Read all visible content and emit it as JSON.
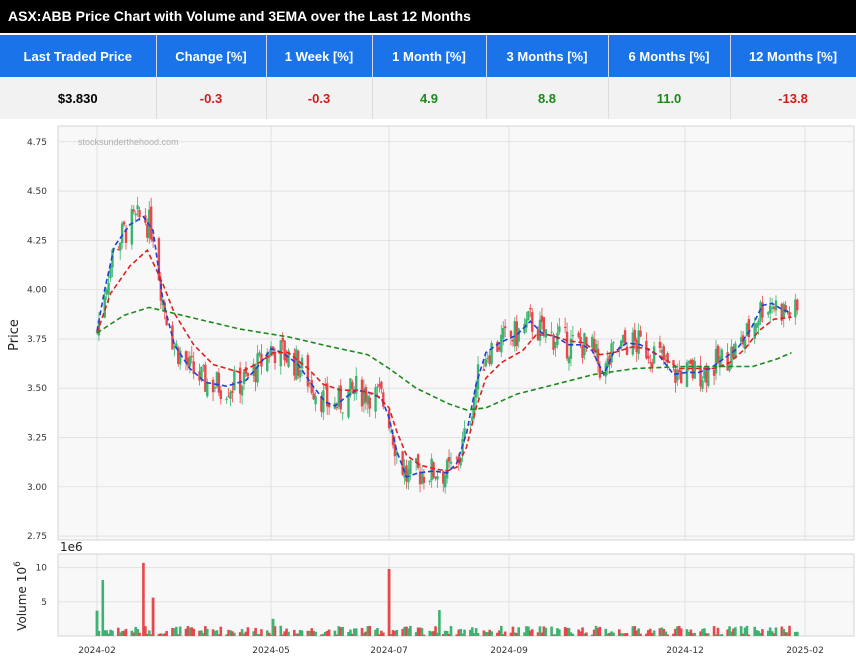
{
  "title": "ASX:ABB Price Chart with Volume and 3EMA over the Last 12 Months",
  "stats": {
    "headers": [
      "Last Traded Price",
      "Change [%]",
      "1 Week [%]",
      "1 Month [%]",
      "3 Months [%]",
      "6 Months [%]",
      "12 Months [%]"
    ],
    "values": [
      "$3.830",
      "-0.3",
      "-0.3",
      "4.9",
      "8.8",
      "11.0",
      "-13.8"
    ],
    "value_colors": [
      "#000000",
      "#d61a1a",
      "#d61a1a",
      "#1a8a1a",
      "#1a8a1a",
      "#1a8a1a",
      "#d61a1a"
    ]
  },
  "chart_data": {
    "type": "line",
    "watermark": "stocksunderthehood.com",
    "ylabel": "Price",
    "volume_label": "Volume",
    "volume_unit": "1e6",
    "volume_exponent_label": "10",
    "volume_exponent": "6",
    "x_ticks": [
      "2024-02",
      "2024-05",
      "2024-07",
      "2024-09",
      "2024-12",
      "2025-02"
    ],
    "x_tick_dates": [
      "2024-02-01",
      "2024-05-01",
      "2024-07-01",
      "2024-09-01",
      "2024-12-01",
      "2025-02-01"
    ],
    "y_ticks": [
      "2.75",
      "3.00",
      "3.25",
      "3.50",
      "3.75",
      "4.00",
      "4.25",
      "4.50",
      "4.75"
    ],
    "ylim": [
      2.73,
      4.83
    ],
    "volume_ticks": [
      "5",
      "10"
    ],
    "volume_ylim": [
      0,
      12
    ],
    "grid": true,
    "up_color": "#3cb371",
    "down_color": "#e8474b",
    "series": [
      {
        "color": "#1f3fd6",
        "style": "dashed",
        "points": [
          [
            "2024-02-01",
            3.79
          ],
          [
            "2024-02-05",
            4.0
          ],
          [
            "2024-02-10",
            4.22
          ],
          [
            "2024-02-18",
            4.33
          ],
          [
            "2024-02-25",
            4.37
          ],
          [
            "2024-03-01",
            4.3
          ],
          [
            "2024-03-06",
            3.95
          ],
          [
            "2024-03-12",
            3.72
          ],
          [
            "2024-03-20",
            3.6
          ],
          [
            "2024-03-28",
            3.53
          ],
          [
            "2024-04-08",
            3.51
          ],
          [
            "2024-04-18",
            3.54
          ],
          [
            "2024-04-25",
            3.62
          ],
          [
            "2024-05-01",
            3.7
          ],
          [
            "2024-05-07",
            3.68
          ],
          [
            "2024-05-15",
            3.62
          ],
          [
            "2024-05-22",
            3.52
          ],
          [
            "2024-05-29",
            3.43
          ],
          [
            "2024-06-03",
            3.41
          ],
          [
            "2024-06-08",
            3.45
          ],
          [
            "2024-06-14",
            3.49
          ],
          [
            "2024-06-20",
            3.48
          ],
          [
            "2024-06-27",
            3.45
          ],
          [
            "2024-07-01",
            3.35
          ],
          [
            "2024-07-05",
            3.18
          ],
          [
            "2024-07-10",
            3.05
          ],
          [
            "2024-07-16",
            3.07
          ],
          [
            "2024-07-24",
            3.08
          ],
          [
            "2024-07-31",
            3.07
          ],
          [
            "2024-08-05",
            3.12
          ],
          [
            "2024-08-10",
            3.27
          ],
          [
            "2024-08-15",
            3.52
          ],
          [
            "2024-08-20",
            3.68
          ],
          [
            "2024-08-27",
            3.73
          ],
          [
            "2024-09-05",
            3.77
          ],
          [
            "2024-09-12",
            3.84
          ],
          [
            "2024-09-18",
            3.78
          ],
          [
            "2024-09-25",
            3.76
          ],
          [
            "2024-10-02",
            3.72
          ],
          [
            "2024-10-09",
            3.72
          ],
          [
            "2024-10-14",
            3.69
          ],
          [
            "2024-10-20",
            3.57
          ],
          [
            "2024-10-25",
            3.68
          ],
          [
            "2024-11-01",
            3.73
          ],
          [
            "2024-11-08",
            3.72
          ],
          [
            "2024-11-13",
            3.69
          ],
          [
            "2024-11-18",
            3.66
          ],
          [
            "2024-11-25",
            3.57
          ],
          [
            "2024-12-02",
            3.58
          ],
          [
            "2024-12-08",
            3.58
          ],
          [
            "2024-12-14",
            3.6
          ],
          [
            "2024-12-21",
            3.65
          ],
          [
            "2024-12-28",
            3.7
          ],
          [
            "2025-01-04",
            3.8
          ],
          [
            "2025-01-10",
            3.92
          ],
          [
            "2025-01-15",
            3.93
          ],
          [
            "2025-01-20",
            3.9
          ],
          [
            "2025-01-25",
            3.88
          ]
        ]
      },
      {
        "color": "#e02020",
        "style": "dashed",
        "points": [
          [
            "2024-02-01",
            3.78
          ],
          [
            "2024-02-08",
            3.98
          ],
          [
            "2024-02-18",
            4.12
          ],
          [
            "2024-02-27",
            4.2
          ],
          [
            "2024-03-06",
            4.03
          ],
          [
            "2024-03-12",
            3.88
          ],
          [
            "2024-03-22",
            3.72
          ],
          [
            "2024-04-01",
            3.62
          ],
          [
            "2024-04-15",
            3.58
          ],
          [
            "2024-04-25",
            3.63
          ],
          [
            "2024-05-02",
            3.68
          ],
          [
            "2024-05-10",
            3.68
          ],
          [
            "2024-05-20",
            3.6
          ],
          [
            "2024-05-28",
            3.52
          ],
          [
            "2024-06-06",
            3.49
          ],
          [
            "2024-06-15",
            3.49
          ],
          [
            "2024-06-24",
            3.47
          ],
          [
            "2024-07-01",
            3.4
          ],
          [
            "2024-07-05",
            3.28
          ],
          [
            "2024-07-10",
            3.16
          ],
          [
            "2024-07-17",
            3.11
          ],
          [
            "2024-07-25",
            3.09
          ],
          [
            "2024-07-31",
            3.08
          ],
          [
            "2024-08-05",
            3.1
          ],
          [
            "2024-08-10",
            3.2
          ],
          [
            "2024-08-15",
            3.4
          ],
          [
            "2024-08-20",
            3.55
          ],
          [
            "2024-08-28",
            3.63
          ],
          [
            "2024-09-08",
            3.69
          ],
          [
            "2024-09-15",
            3.77
          ],
          [
            "2024-09-22",
            3.77
          ],
          [
            "2024-10-02",
            3.74
          ],
          [
            "2024-10-10",
            3.73
          ],
          [
            "2024-10-18",
            3.67
          ],
          [
            "2024-10-25",
            3.68
          ],
          [
            "2024-11-04",
            3.71
          ],
          [
            "2024-11-12",
            3.7
          ],
          [
            "2024-11-20",
            3.65
          ],
          [
            "2024-11-28",
            3.6
          ],
          [
            "2024-12-08",
            3.6
          ],
          [
            "2024-12-16",
            3.6
          ],
          [
            "2024-12-24",
            3.63
          ],
          [
            "2025-01-01",
            3.7
          ],
          [
            "2025-01-08",
            3.79
          ],
          [
            "2025-01-16",
            3.85
          ],
          [
            "2025-01-25",
            3.86
          ]
        ]
      },
      {
        "color": "#1e8a1e",
        "style": "dashed",
        "points": [
          [
            "2024-02-01",
            3.78
          ],
          [
            "2024-02-15",
            3.87
          ],
          [
            "2024-02-28",
            3.91
          ],
          [
            "2024-03-20",
            3.86
          ],
          [
            "2024-04-15",
            3.8
          ],
          [
            "2024-05-10",
            3.76
          ],
          [
            "2024-06-01",
            3.71
          ],
          [
            "2024-06-20",
            3.67
          ],
          [
            "2024-07-01",
            3.6
          ],
          [
            "2024-07-15",
            3.5
          ],
          [
            "2024-08-01",
            3.42
          ],
          [
            "2024-08-10",
            3.39
          ],
          [
            "2024-08-20",
            3.4
          ],
          [
            "2024-09-05",
            3.47
          ],
          [
            "2024-09-25",
            3.52
          ],
          [
            "2024-10-15",
            3.57
          ],
          [
            "2024-11-05",
            3.6
          ],
          [
            "2024-12-01",
            3.61
          ],
          [
            "2024-12-20",
            3.61
          ],
          [
            "2025-01-05",
            3.61
          ],
          [
            "2025-01-18",
            3.65
          ],
          [
            "2025-01-25",
            3.68
          ]
        ]
      }
    ],
    "volume_spikes": [
      [
        "2024-02-01",
        3.7,
        "up"
      ],
      [
        "2024-02-04",
        8.2,
        "up"
      ],
      [
        "2024-02-25",
        10.7,
        "down"
      ],
      [
        "2024-03-01",
        5.6,
        "down"
      ],
      [
        "2024-07-01",
        9.8,
        "down"
      ],
      [
        "2024-07-27",
        3.8,
        "up"
      ],
      [
        "2024-05-02",
        2.5,
        "up"
      ],
      [
        "2025-01-28",
        0.6,
        "up"
      ]
    ]
  }
}
